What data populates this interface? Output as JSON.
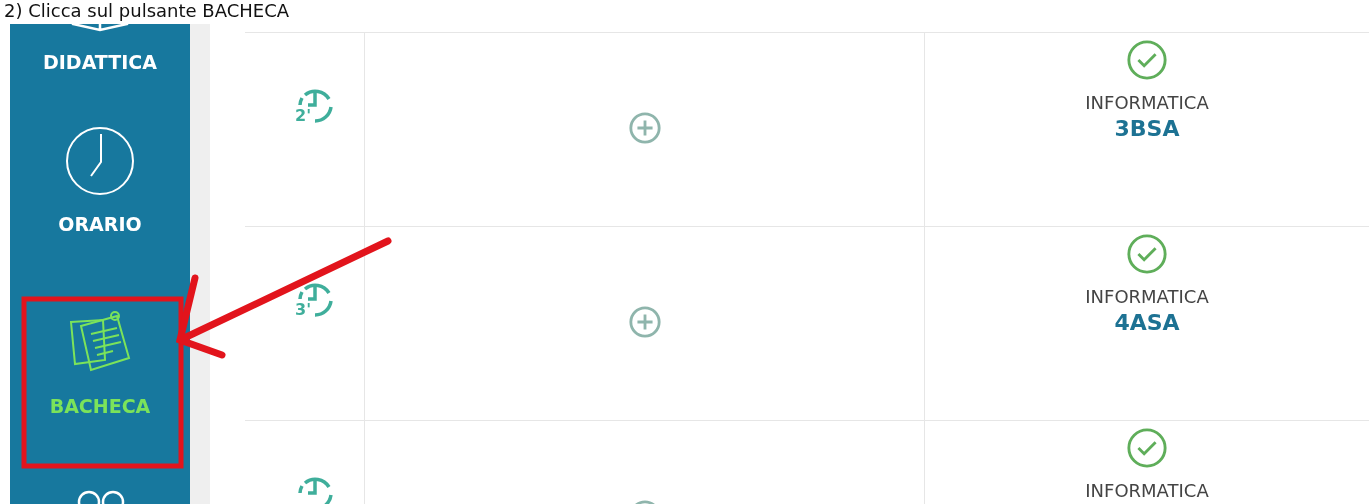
{
  "caption": "2) Clicca sul pulsante BACHECA",
  "sidebar": {
    "items": [
      {
        "kind": "book",
        "label": "DIDATTICA",
        "selected": false
      },
      {
        "kind": "clock",
        "label": "ORARIO",
        "selected": false
      },
      {
        "kind": "notes",
        "label": "BACHECA",
        "selected": true
      },
      {
        "kind": "people",
        "selected": false
      }
    ]
  },
  "rows": [
    {
      "hour": "2'",
      "subject": "INFORMATICA",
      "class": "3BSA"
    },
    {
      "hour": "3'",
      "subject": "INFORMATICA",
      "class": "4ASA"
    },
    {
      "subject": "INFORMATICA"
    }
  ]
}
